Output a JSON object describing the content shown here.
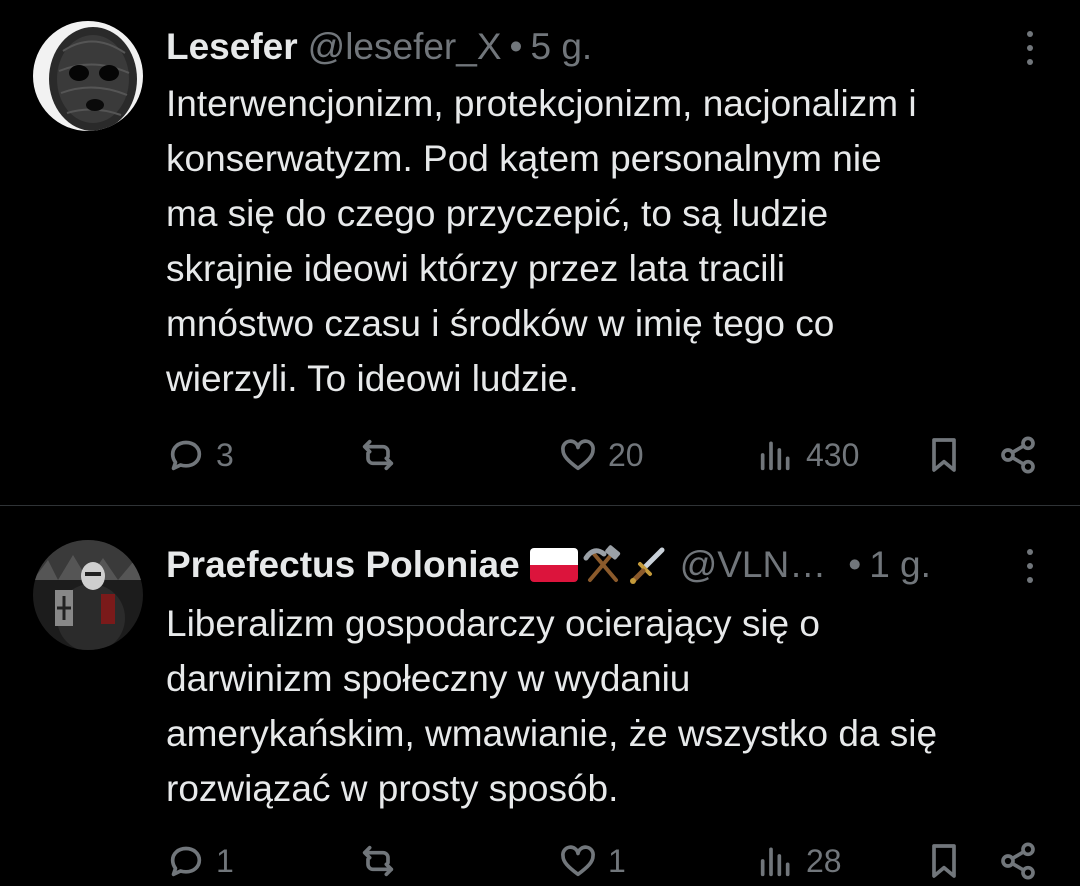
{
  "tweets": [
    {
      "author_name": "Lesefer",
      "handle": "@lesefer_X",
      "separator": "•",
      "time": "5 g.",
      "text": "Interwencjonizm, protekcjonizm, nacjonalizm i\nkonserwatyzm. Pod kątem personalnym nie\nma się do czego przyczepić, to są ludzie\nskrajnie ideowi którzy przez lata tracili\nmnóstwo czasu i środków w imię tego co\nwierzyli. To ideowi ludzie.",
      "stats": {
        "replies": "3",
        "retweets": "",
        "likes": "20",
        "views": "430"
      }
    },
    {
      "author_name": "Praefectus Poloniae",
      "handle": "@VLN…",
      "separator": "•",
      "time": "1 g.",
      "name_emojis": [
        "flag-poland-icon",
        "hammer-and-pick-icon",
        "dagger-icon"
      ],
      "text": "Liberalizm gospodarczy ocierający się o\ndarwinizm społeczny w wydaniu\namerykańskim, wmawianie, że wszystko da się\nrozwiązać w prosty sposób.",
      "stats": {
        "replies": "1",
        "retweets": "",
        "likes": "1",
        "views": "28"
      }
    }
  ],
  "colors": {
    "background": "#000000",
    "text_primary": "#e7e9ea",
    "text_secondary": "#71767b",
    "divider": "#2f3336"
  }
}
